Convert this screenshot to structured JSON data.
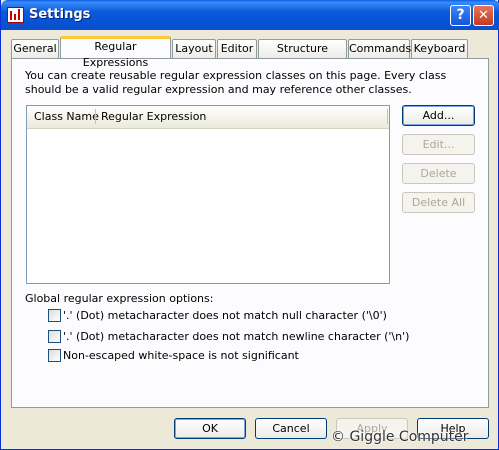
{
  "window": {
    "title": "Settings",
    "help_glyph": "?",
    "close_glyph": "✕"
  },
  "tabs": [
    {
      "label": "General"
    },
    {
      "label": "Regular Expressions"
    },
    {
      "label": "Layout"
    },
    {
      "label": "Editor"
    },
    {
      "label": "Structure Viewer"
    },
    {
      "label": "Commands"
    },
    {
      "label": "Keyboard"
    }
  ],
  "active_tab": "Regular Expressions",
  "panel": {
    "description": "You can create reusable regular expression classes on this page. Every class should be a valid regular expression and may reference other classes.",
    "list_columns": [
      "Class Name",
      "Regular Expression"
    ],
    "list_rows": [],
    "buttons": {
      "add": "Add...",
      "edit": "Edit...",
      "delete": "Delete",
      "delete_all": "Delete All"
    },
    "options_label": "Global regular expression options:",
    "options": [
      {
        "label": "'.' (Dot) metacharacter does not match null character ('\\0')",
        "checked": false
      },
      {
        "label": "'.' (Dot) metacharacter does not match newline character ('\\n')",
        "checked": false
      },
      {
        "label": "Non-escaped white-space is not significant",
        "checked": false
      }
    ]
  },
  "footer": {
    "ok": "OK",
    "cancel": "Cancel",
    "apply": "Apply",
    "help": "Help"
  },
  "watermark": "© Giggle Computer",
  "colors": {
    "titlebar": "#0a5ad8",
    "dialog_bg": "#ece9d8",
    "active_tab_accent": "#ffc83c",
    "disabled_text": "#aca899"
  }
}
